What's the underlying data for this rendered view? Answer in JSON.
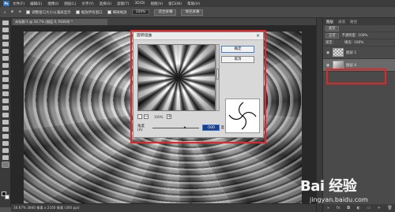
{
  "app": {
    "logo": "Ps",
    "menu": [
      "文件(F)",
      "编辑(E)",
      "图像(I)",
      "图层(L)",
      "文字(Y)",
      "选择(S)",
      "滤镜(T)",
      "3D(D)",
      "视图(V)",
      "窗口(W)",
      "帮助(H)"
    ]
  },
  "options_bar": {
    "tool_icon": "zoom-icon",
    "resize_windows": "调整窗口大小以满屏显示",
    "zoom_all": "缩放所有窗口",
    "scrubby_zoom": "细微缩放",
    "zoom_pct": "100%",
    "fit_screen": "适合屏幕",
    "fill_screen": "填充屏幕"
  },
  "document": {
    "tab_title": "未标题-1 @ 16.7% (图层 0, RGB/8) *",
    "status": "16.67%   3840 像素 x 2160 像素 (300 ppi)"
  },
  "dialog": {
    "title": "旋转扭曲",
    "ok": "确定",
    "cancel": "取消",
    "zoom": "100%",
    "angle_label": "角度(A)",
    "angle_value": "-500",
    "angle_unit": "度",
    "slider_fraction": 0.67
  },
  "panel": {
    "tabs": [
      "图层",
      "通道",
      "路径"
    ],
    "kind_filter": "类型",
    "blend_mode": "正常",
    "opacity_label": "不透明度:",
    "opacity": "100%",
    "lock_label": "锁定:",
    "fill_label": "填充:",
    "fill": "100%",
    "layers": [
      {
        "name": "图层 1",
        "selected": false
      },
      {
        "name": "图层 0",
        "selected": true
      }
    ]
  },
  "watermark": {
    "main": "Bai 经验",
    "sub": "jingyan.baidu.com"
  },
  "colors": {
    "highlight_red": "#e0282a",
    "ps_blue": "#2b6fb6"
  }
}
